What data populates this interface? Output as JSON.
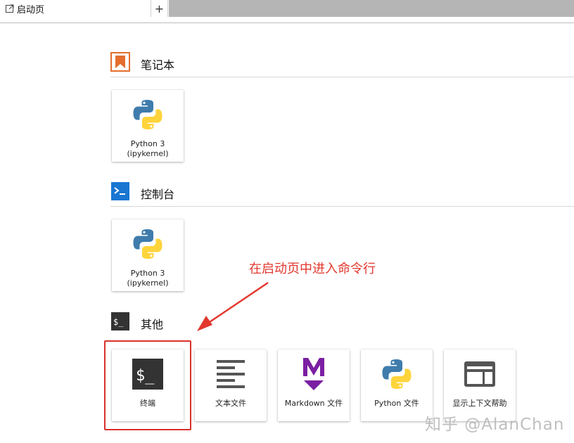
{
  "tabbar": {
    "active_tab_label": "启动页",
    "new_tab_label": "+"
  },
  "sections": {
    "notebook": {
      "title": "笔记本",
      "cards": [
        {
          "line1": "Python 3",
          "line2": "(ipykernel)"
        }
      ]
    },
    "console": {
      "title": "控制台",
      "cards": [
        {
          "line1": "Python 3",
          "line2": "(ipykernel)"
        }
      ]
    },
    "other": {
      "title": "其他",
      "cards": [
        {
          "label": "终端"
        },
        {
          "label": "文本文件"
        },
        {
          "label": "Markdown 文件"
        },
        {
          "label": "Python 文件"
        },
        {
          "label": "显示上下文帮助"
        }
      ]
    }
  },
  "annotation": {
    "text": "在启动页中进入命令行",
    "color": "#e2372d"
  },
  "watermark": "知乎 @AlanChan",
  "colors": {
    "notebook_icon": "#e46e2e",
    "console_icon": "#1976d2",
    "other_icon": "#333333",
    "markdown_icon": "#7b1fa2",
    "python_blue": "#3f7cac",
    "python_yellow": "#ffd43b",
    "highlight_border": "#d8322c"
  },
  "icons": {
    "tab": "launcher-icon",
    "notebook": "notebook-bookmark-icon",
    "console": "console-prompt-icon",
    "other": "terminal-dollar-icon",
    "python": "python-logo-icon",
    "terminal": "terminal-icon",
    "text_file": "text-lines-icon",
    "markdown": "markdown-m-icon",
    "help": "context-help-icon"
  }
}
